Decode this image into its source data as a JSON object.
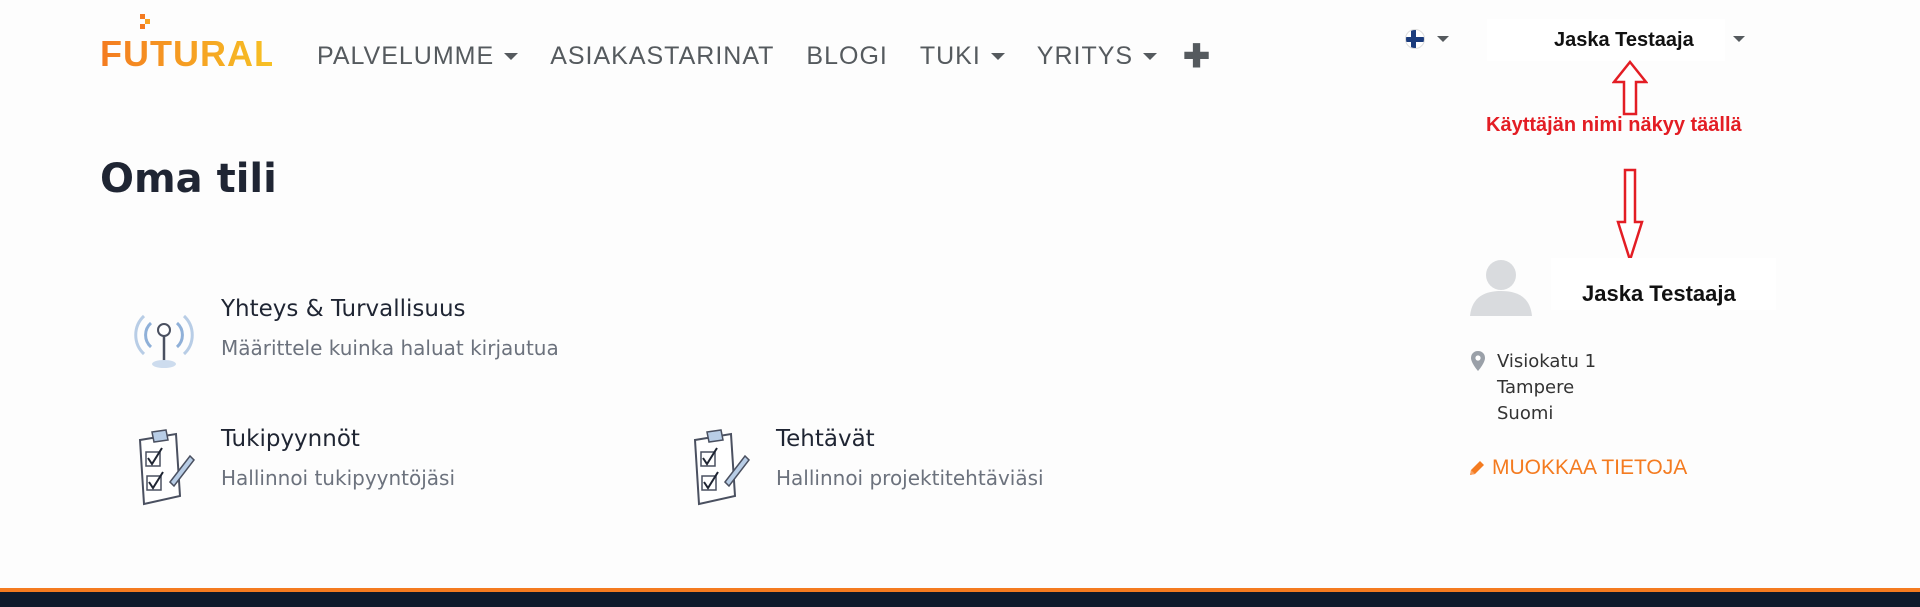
{
  "header": {
    "logo_text": "FUTURAL",
    "nav": [
      {
        "label": "PALVELUMME",
        "dropdown": true
      },
      {
        "label": "ASIAKASTARINAT",
        "dropdown": false
      },
      {
        "label": "BLOGI",
        "dropdown": false
      },
      {
        "label": "TUKI",
        "dropdown": true
      },
      {
        "label": "YRITYS",
        "dropdown": true
      }
    ],
    "plus_label": "✚",
    "language": "fi",
    "user_name": "Jaska Testaaja"
  },
  "annotation": {
    "text": "Käyttäjän nimi näkyy täällä",
    "color": "#e31d24"
  },
  "main": {
    "title": "Oma tili",
    "cards": [
      {
        "title": "Yhteys & Turvallisuus",
        "subtitle": "Määrittele kuinka haluat kirjautua",
        "icon": "antenna-icon"
      },
      {
        "title": "Tukipyynnöt",
        "subtitle": "Hallinnoi tukipyyntöjäsi",
        "icon": "clipboard-icon"
      },
      {
        "title": "Tehtävät",
        "subtitle": "Hallinnoi projektitehtäviäsi",
        "icon": "clipboard-icon"
      }
    ]
  },
  "profile": {
    "name": "Jaska Testaaja",
    "address": [
      "Visiokatu 1",
      "Tampere",
      "Suomi"
    ],
    "edit_label": "MUOKKAA TIETOJA"
  },
  "colors": {
    "accent": "#f47b20",
    "logo_yellow": "#f7c325",
    "text_dark": "#1f2533",
    "footer": "#0e1a2b"
  }
}
